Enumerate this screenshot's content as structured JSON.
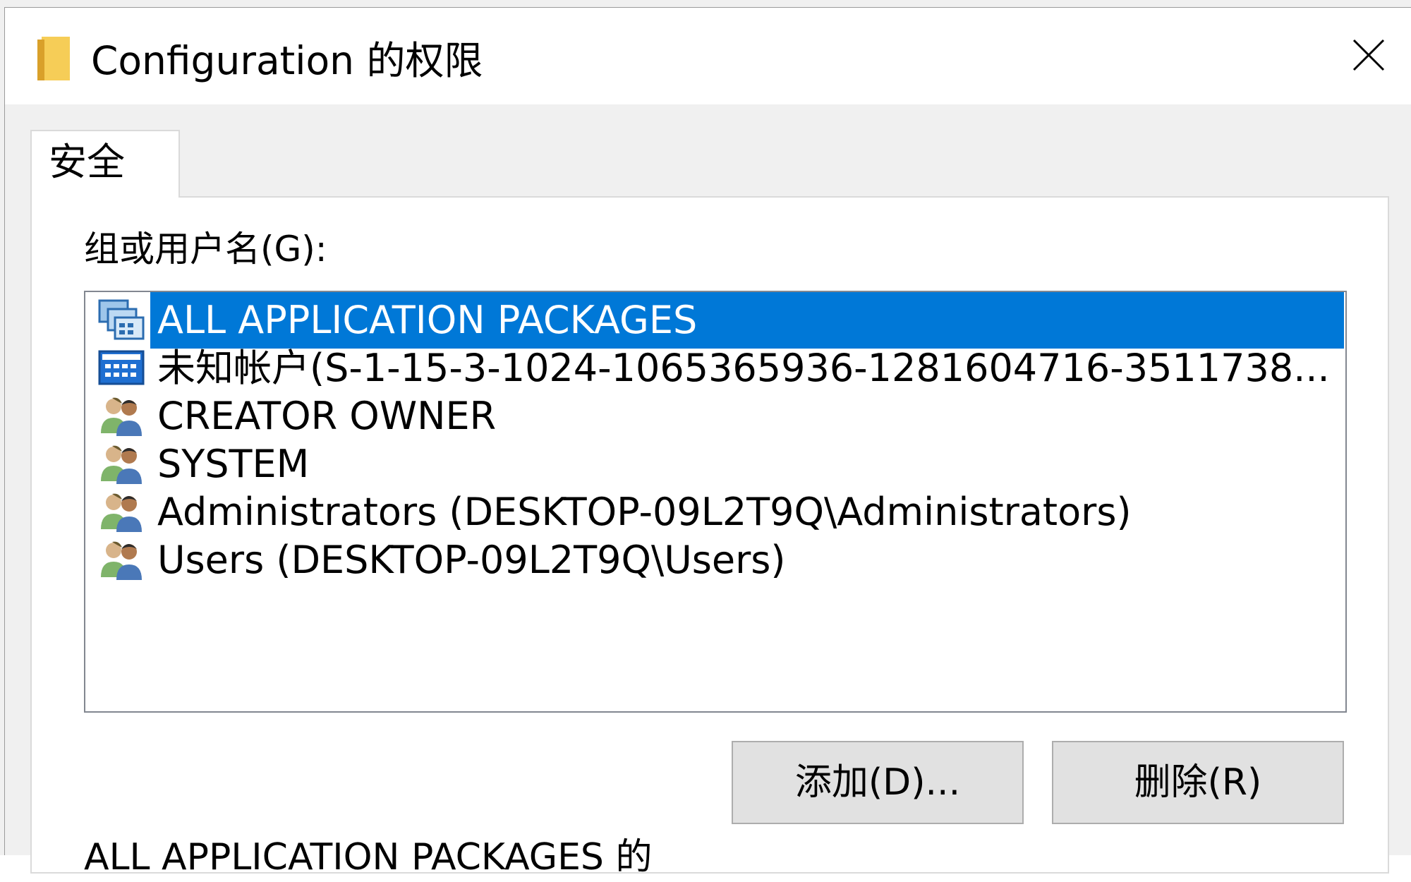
{
  "window": {
    "title": "Configuration 的权限",
    "folder_icon": "folder-icon",
    "close_icon": "close-icon"
  },
  "tabs": [
    {
      "label": "安全",
      "selected": true
    }
  ],
  "security": {
    "group_label": "组或用户名(G):",
    "principals": [
      {
        "name": "ALL APPLICATION PACKAGES",
        "icon": "app-packages-icon",
        "selected": true
      },
      {
        "name": "未知帐户(S-1-15-3-1024-1065365936-1281604716-3511738...",
        "icon": "unknown-account-icon",
        "selected": false
      },
      {
        "name": "CREATOR OWNER",
        "icon": "users-group-icon",
        "selected": false
      },
      {
        "name": "SYSTEM",
        "icon": "users-group-icon",
        "selected": false
      },
      {
        "name": "Administrators (DESKTOP-09L2T9Q\\Administrators)",
        "icon": "users-group-icon",
        "selected": false
      },
      {
        "name": "Users (DESKTOP-09L2T9Q\\Users)",
        "icon": "users-group-icon",
        "selected": false
      }
    ],
    "add_button": "添加(D)...",
    "remove_button": "删除(R)",
    "permissions_label": "ALL APPLICATION PACKAGES 的"
  },
  "colors": {
    "selection": "#0078d7",
    "selection_text": "#ffffff"
  }
}
